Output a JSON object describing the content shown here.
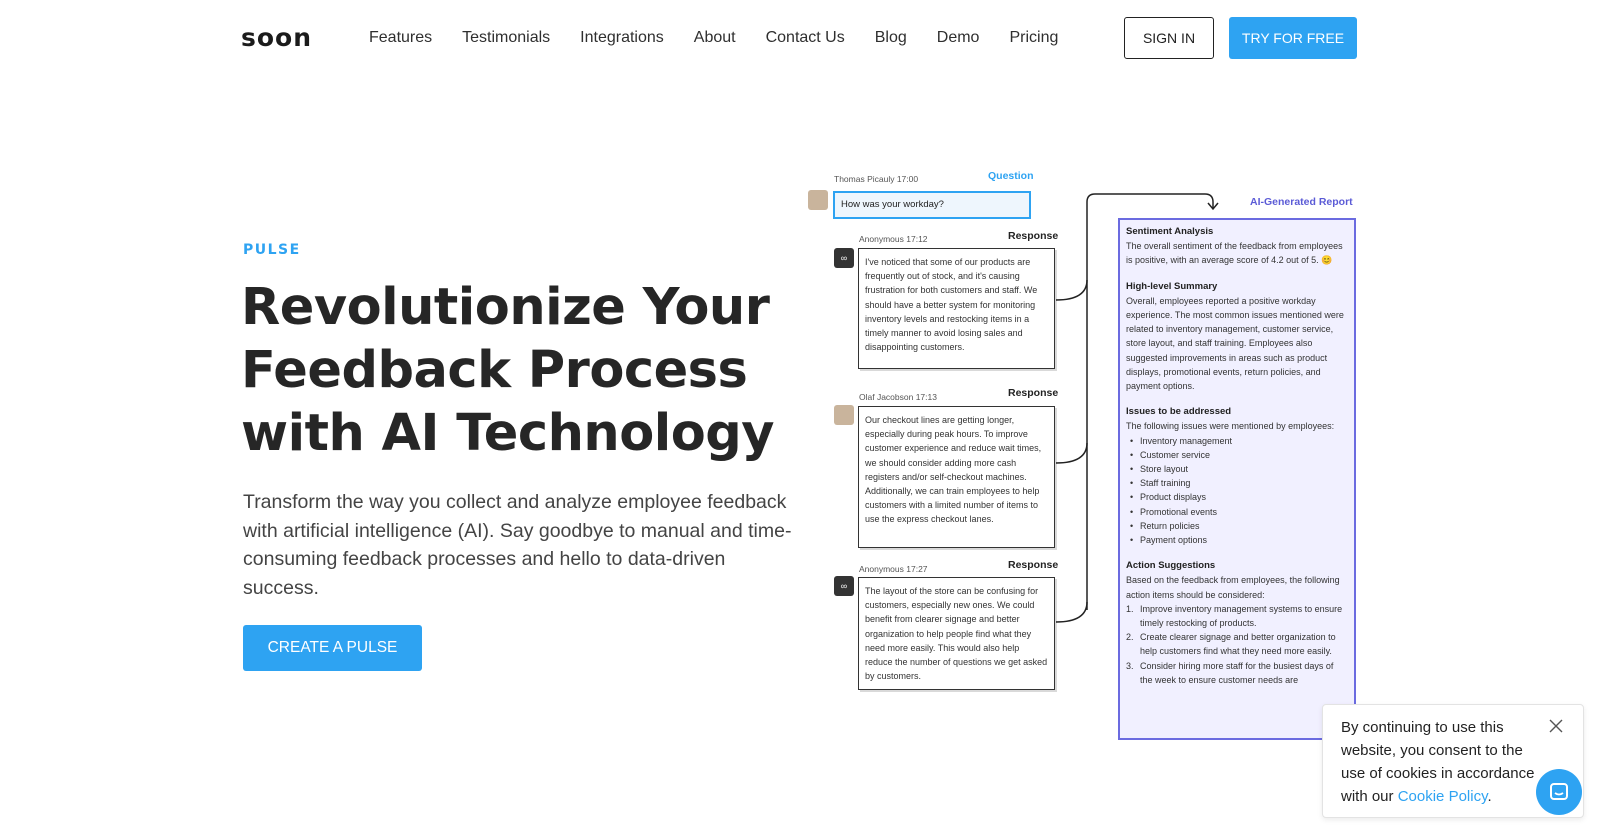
{
  "header": {
    "logo": "soon",
    "nav": [
      "Features",
      "Testimonials",
      "Integrations",
      "About",
      "Contact Us",
      "Blog",
      "Demo",
      "Pricing"
    ],
    "sign_in": "SIGN IN",
    "try_free": "TRY FOR FREE"
  },
  "hero": {
    "eyebrow": "PULSE",
    "headline": "Revolutionize Your Feedback Process with AI Technology",
    "subtext": "Transform the way you collect and analyze employee feedback with artificial intelligence (AI). Say goodbye to manual and time-consuming feedback processes and hello to data-driven success.",
    "cta": "CREATE A PULSE"
  },
  "illustration": {
    "question_meta": "Thomas Picauly  17:00",
    "question_tag": "Question",
    "question_text": "How was your workday?",
    "report_tag": "AI-Generated Report",
    "responses": [
      {
        "meta": "Anonymous  17:12",
        "tag": "Response",
        "avatar": "glasses-icon",
        "text": "I've noticed that some of our products are frequently out of stock, and it's causing frustration for both customers and staff. We should have a better system for monitoring inventory levels and restocking items in a timely manner to avoid losing sales and disappointing customers."
      },
      {
        "meta": "Olaf Jacobson  17:13",
        "tag": "Response",
        "avatar": "person-photo",
        "text": "Our checkout lines are getting longer, especially during peak hours. To improve customer experience and reduce wait times, we should consider adding more cash registers and/or self-checkout machines. Additionally, we can train employees to help customers with a limited number of items to use the express checkout lanes."
      },
      {
        "meta": "Anonymous  17:27",
        "tag": "Response",
        "avatar": "glasses-icon",
        "text": "The layout of the store can be confusing for customers, especially new ones. We could benefit from clearer signage and better organization to help people find what they need more easily. This would also help reduce the number of questions we get asked by customers."
      }
    ],
    "report": {
      "sentiment_title": "Sentiment Analysis",
      "sentiment_text": "The overall sentiment of the feedback from employees is positive, with an average score of 4.2 out of 5. 😊",
      "summary_title": "High-level Summary",
      "summary_text": "Overall, employees reported a positive workday experience. The most common issues mentioned were related to inventory management, customer service, store layout, and staff training. Employees also suggested improvements in areas such as product displays, promotional events, return policies, and payment options.",
      "issues_title": "Issues to be addressed",
      "issues_intro": "The following issues were mentioned by employees:",
      "issues": [
        "Inventory management",
        "Customer service",
        "Store layout",
        "Staff training",
        "Product displays",
        "Promotional events",
        "Return policies",
        "Payment options"
      ],
      "actions_title": "Action Suggestions",
      "actions_intro": "Based on the feedback from employees, the following action items should be considered:",
      "actions": [
        "Improve inventory management systems to ensure timely restocking of products.",
        "Create clearer signage and better organization to help customers find what they need more easily.",
        "Consider hiring more staff for the busiest days of the week to ensure customer needs are"
      ]
    }
  },
  "cookie": {
    "text": "By continuing to use this website, you consent to the use of cookies in accordance with our ",
    "link": "Cookie Policy",
    "end": "."
  },
  "colors": {
    "accent": "#2ea3f2",
    "report_border": "#6b6be0",
    "report_bg": "#f1f0ff"
  }
}
